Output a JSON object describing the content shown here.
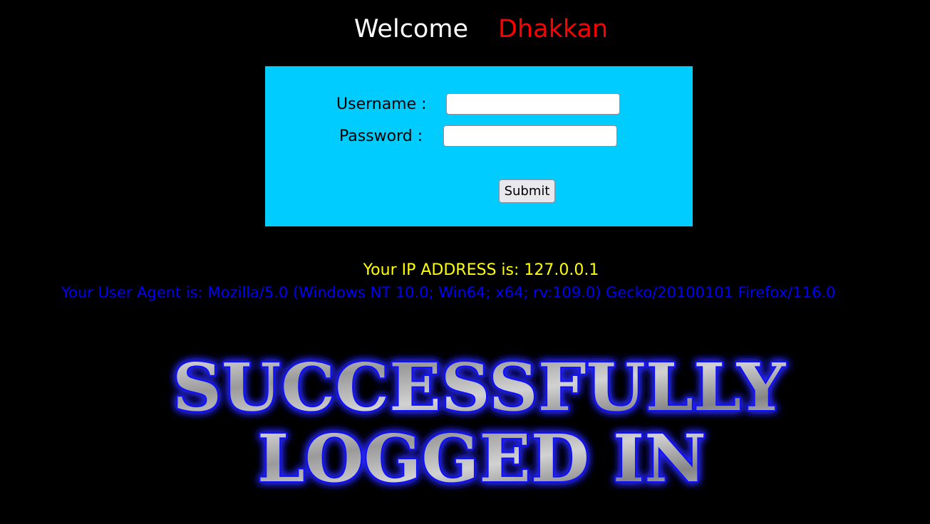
{
  "header": {
    "welcome_label": "Welcome",
    "user_name": "Dhakkan"
  },
  "login_form": {
    "username_label": "Username :",
    "password_label": "Password :",
    "username_value": "",
    "password_value": "",
    "submit_label": "Submit"
  },
  "info": {
    "ip_line": "Your IP ADDRESS is: 127.0.0.1",
    "user_agent_line": "Your User Agent is: Mozilla/5.0 (Windows NT 10.0; Win64; x64; rv:109.0) Gecko/20100101 Firefox/116.0"
  },
  "banner": {
    "line1": "SUCCESSFULLY",
    "line2": "LOGGED IN"
  },
  "colors": {
    "background": "#000000",
    "form_background": "#00ccff",
    "welcome_text": "#ffffff",
    "user_name_text": "#ff0000",
    "ip_text": "#ffff00",
    "user_agent_text": "#0000ff",
    "banner_glow": "#2a2aff"
  }
}
